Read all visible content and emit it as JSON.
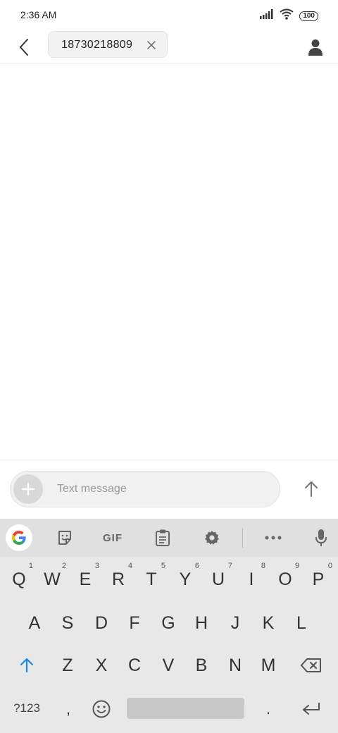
{
  "status": {
    "time": "2:36 AM",
    "battery": "100"
  },
  "header": {
    "recipient": "18730218809"
  },
  "compose": {
    "placeholder": "Text message"
  },
  "toolbar": {
    "gif_label": "GIF"
  },
  "keyboard": {
    "row1": [
      {
        "key": "Q",
        "hint": "1"
      },
      {
        "key": "W",
        "hint": "2"
      },
      {
        "key": "E",
        "hint": "3"
      },
      {
        "key": "R",
        "hint": "4"
      },
      {
        "key": "T",
        "hint": "5"
      },
      {
        "key": "Y",
        "hint": "6"
      },
      {
        "key": "U",
        "hint": "7"
      },
      {
        "key": "I",
        "hint": "8"
      },
      {
        "key": "O",
        "hint": "9"
      },
      {
        "key": "P",
        "hint": "0"
      }
    ],
    "row2": [
      "A",
      "S",
      "D",
      "F",
      "G",
      "H",
      "J",
      "K",
      "L"
    ],
    "row3": [
      "Z",
      "X",
      "C",
      "V",
      "B",
      "N",
      "M"
    ],
    "sym_label": "?123",
    "comma": ",",
    "period": "."
  }
}
